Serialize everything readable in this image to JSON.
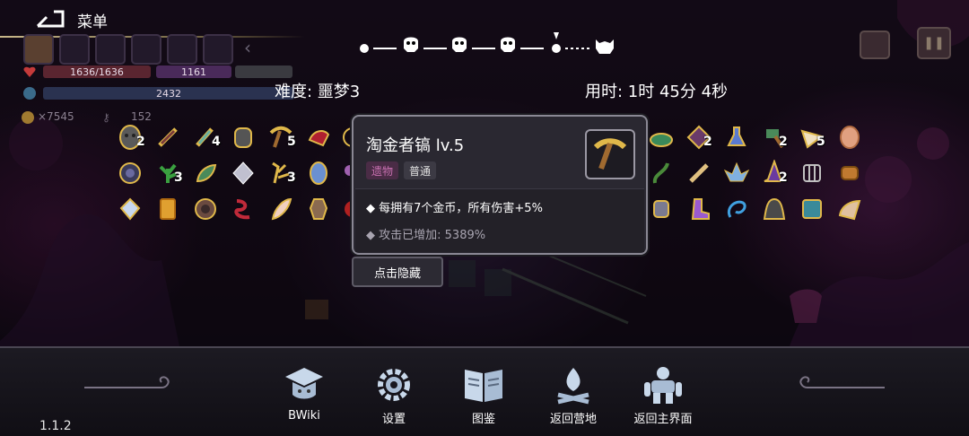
{
  "top": {
    "menu_label": "菜单"
  },
  "hud": {
    "hp": "1636/1636",
    "shield": "1161",
    "mana": "2432",
    "coins": "×7545",
    "keys": "152"
  },
  "run": {
    "difficulty": "难度: 噩梦3",
    "time": "用时: 1时 45分 4秒"
  },
  "items": {
    "counts": [
      "2",
      "4",
      "5",
      "3",
      "3",
      "2",
      "2",
      "5",
      "2"
    ]
  },
  "popup": {
    "title": "淘金者镐 lv.5",
    "tag_type": "遗物",
    "tag_rarity": "普通",
    "effect": "每拥有7个金币，所有伤害+5%",
    "bonus": "攻击已增加: 5389%",
    "hide_button": "点击隐藏"
  },
  "nav": {
    "bwiki": "BWiki",
    "settings": "设置",
    "codex": "图鉴",
    "camp": "返回营地",
    "main": "返回主界面"
  },
  "version": "1.1.2",
  "colors": {
    "accent_gold": "#e0b84a",
    "popup_bg": "#2a2831",
    "tag_purple": "#4a2c46"
  }
}
